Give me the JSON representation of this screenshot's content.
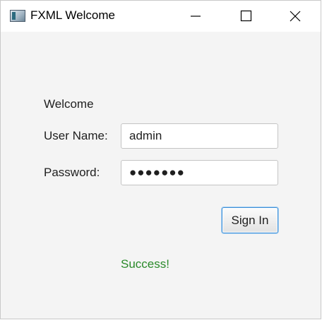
{
  "window": {
    "title": "FXML Welcome",
    "icon": "java-app-icon",
    "controls": {
      "minimize": "minimize-icon",
      "maximize": "maximize-icon",
      "close": "close-icon"
    }
  },
  "form": {
    "heading": "Welcome",
    "username": {
      "label": "User Name:",
      "value": "admin"
    },
    "password": {
      "label": "Password:",
      "masked_value": "●●●●●●●"
    },
    "sign_in_label": "Sign In",
    "status_message": "Success!"
  },
  "colors": {
    "background": "#f4f4f4",
    "titlebar": "#ffffff",
    "status_success": "#2a8a2a",
    "focus_border": "#3d8ed6"
  }
}
